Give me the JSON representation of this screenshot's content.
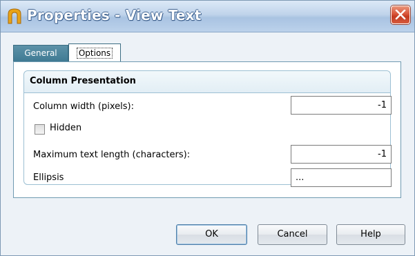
{
  "window": {
    "title": "Properties - View Text",
    "icon": "app-arch-icon",
    "accent_color": "#e8a317",
    "titlebar_color": "#bcd2eb"
  },
  "tabs": [
    {
      "label": "General",
      "selected": false
    },
    {
      "label": "Options",
      "selected": true
    }
  ],
  "group": {
    "title": "Column Presentation",
    "fields": {
      "column_width": {
        "label": "Column width (pixels):",
        "value": "-1"
      },
      "hidden": {
        "label": "Hidden",
        "checked": false
      },
      "max_text_length": {
        "label": "Maximum text length (characters):",
        "value": "-1"
      },
      "ellipsis": {
        "label": "Ellipsis",
        "value": "..."
      }
    }
  },
  "buttons": {
    "ok": "OK",
    "cancel": "Cancel",
    "help": "Help"
  }
}
